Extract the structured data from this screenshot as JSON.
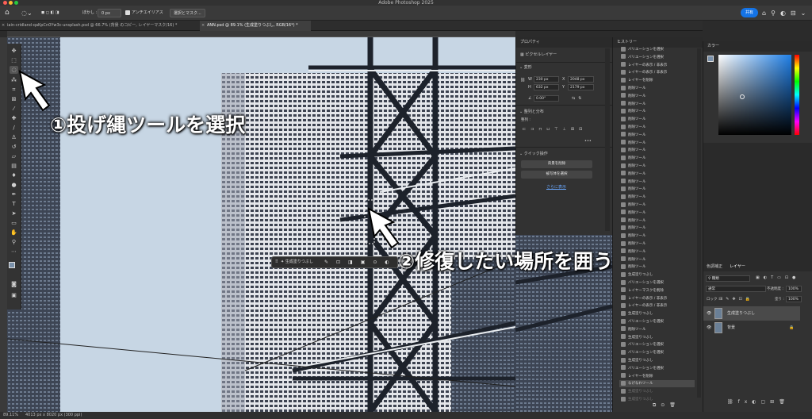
{
  "app": {
    "title": "Adobe Photoshop 2025",
    "share_label": "共有"
  },
  "options_bar": {
    "feather_label": "ぼかし :",
    "feather_value": "0 px",
    "antialias_label": "アンチエイリアス",
    "select_mask_label": "選択とマスク..."
  },
  "tabs": [
    {
      "label": "iain-cridland-qaKpCn0Yw3c-unsplash.psd @ 66.7% (背景 のコピー, レイヤーマスク/16) *"
    },
    {
      "label": "ANN.psd @ 89.1% (生成塗りつぶし, RGB/16*) *"
    }
  ],
  "status": {
    "zoom": "89.11%",
    "doc_size": "4013 px x 8020 px (300 ppi)"
  },
  "annotations": {
    "step1": "①投げ縄ツールを選択",
    "step2": "②修復したい場所を囲う"
  },
  "context_bar": {
    "label": "生成塗りつぶし"
  },
  "properties": {
    "title": "プロパティ",
    "layer_type": "ピクセルレイヤー",
    "transform_title": "変形",
    "w_label": "W",
    "w_value": "230 px",
    "h_label": "H",
    "h_value": "632 px",
    "x_label": "X",
    "x_value": "2048 px",
    "y_label": "Y",
    "y_value": "2179 px",
    "angle_value": "0.00°",
    "align_title": "整列と分布",
    "align_label": "整列 :",
    "more": "•••",
    "quick_title": "クイック操作",
    "btn_remove_bg": "背景を削除",
    "btn_select_subject": "被写体を選択",
    "show_more": "さらに表示"
  },
  "history": {
    "title": "ヒストリー",
    "items": [
      "バリエーションを選択",
      "バリエーションを選択",
      "レイヤーの表示 / 非表示",
      "レイヤーの表示 / 非表示",
      "レイヤーを削除",
      "削除ツール",
      "削除ツール",
      "削除ツール",
      "削除ツール",
      "削除ツール",
      "削除ツール",
      "削除ツール",
      "削除ツール",
      "削除ツール",
      "削除ツール",
      "削除ツール",
      "削除ツール",
      "削除ツール",
      "削除ツール",
      "削除ツール",
      "削除ツール",
      "削除ツール",
      "削除ツール",
      "削除ツール",
      "削除ツール",
      "削除ツール",
      "削除ツール",
      "削除ツール",
      "削除ツール",
      "生成塗りつぶし",
      "バリエーションを選択",
      "レイヤーマスクを削除",
      "レイヤーの表示 / 非表示",
      "レイヤーの表示 / 非表示",
      "生成塗りつぶし",
      "バリエーションを選択",
      "削除ツール",
      "生成塗りつぶし",
      "バリエーションを選択",
      "バリエーションを選択",
      "生成塗りつぶし",
      "バリエーションを選択",
      "レイヤーを削除",
      "なげなわツール",
      "生成塗りつぶし",
      "生成塗りつぶし"
    ],
    "active_index": 43,
    "dim_from": 44
  },
  "color": {
    "title": "カラー"
  },
  "layers": {
    "tab_adjust": "色調補正",
    "tab_layers": "レイヤー",
    "filter_kind": "種類",
    "blend_mode": "通常",
    "opacity_label": "不透明度 :",
    "opacity_value": "100%",
    "lock_label": "ロック :",
    "fill_label": "塗り :",
    "fill_value": "100%",
    "items": [
      {
        "name": "生成塗りつぶし",
        "selected": true
      },
      {
        "name": "背景",
        "selected": false
      }
    ]
  },
  "tools": [
    "move-icon",
    "marquee-icon",
    "lasso-icon",
    "object-select-icon",
    "crop-icon",
    "frame-icon",
    "eyedropper-icon",
    "healing-icon",
    "brush-icon",
    "stamp-icon",
    "history-brush-icon",
    "eraser-icon",
    "gradient-icon",
    "blur-icon",
    "dodge-icon",
    "pen-icon",
    "type-icon",
    "path-select-icon",
    "shape-icon",
    "hand-icon",
    "zoom-icon",
    "more-icon"
  ],
  "colors": {
    "accent": "#1473e6",
    "panel_bg": "#323232",
    "sky": "#c7d6e4"
  }
}
